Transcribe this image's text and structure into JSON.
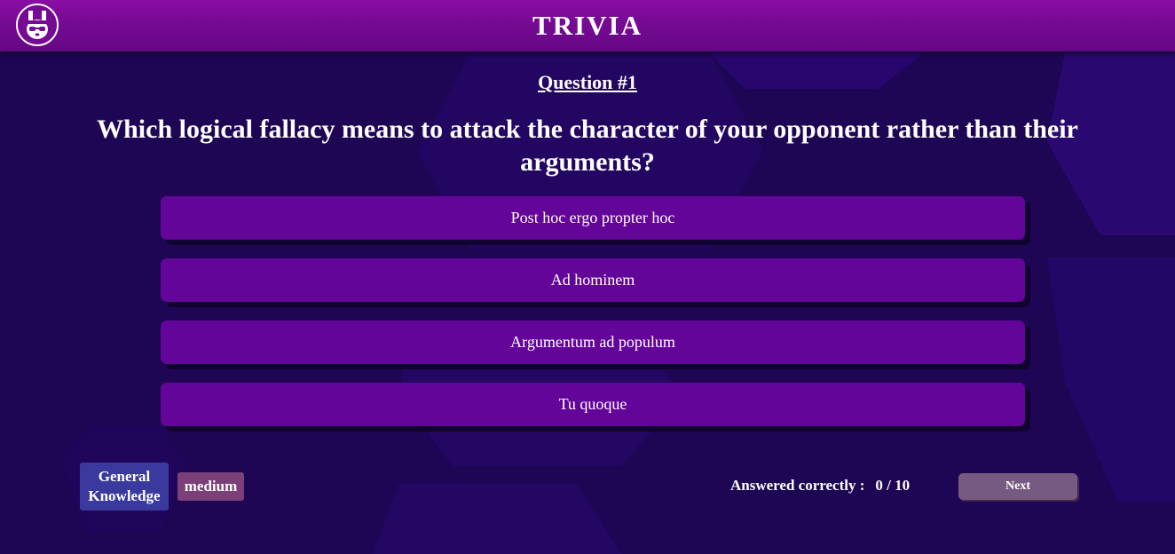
{
  "app": {
    "title": "TRIVIA",
    "logo_icon": "panda-logo-icon"
  },
  "question": {
    "number_label": "Question #1",
    "text": "Which logical fallacy means to attack the character of your opponent rather than their arguments?"
  },
  "answers": [
    {
      "label": "Post hoc ergo propter hoc"
    },
    {
      "label": "Ad hominem"
    },
    {
      "label": "Argumentum ad populum"
    },
    {
      "label": "Tu quoque"
    }
  ],
  "footer": {
    "category": "General Knowledge",
    "difficulty": "medium",
    "score_label": "Answered correctly :",
    "score_value": "0 / 10",
    "next_label": "Next"
  },
  "colors": {
    "background": "#1e0655",
    "header": "#770a95",
    "answer_button": "#640599",
    "category_tag": "#3a3a9e",
    "difficulty_tag": "#7c4079",
    "next_button": "#775a82"
  }
}
